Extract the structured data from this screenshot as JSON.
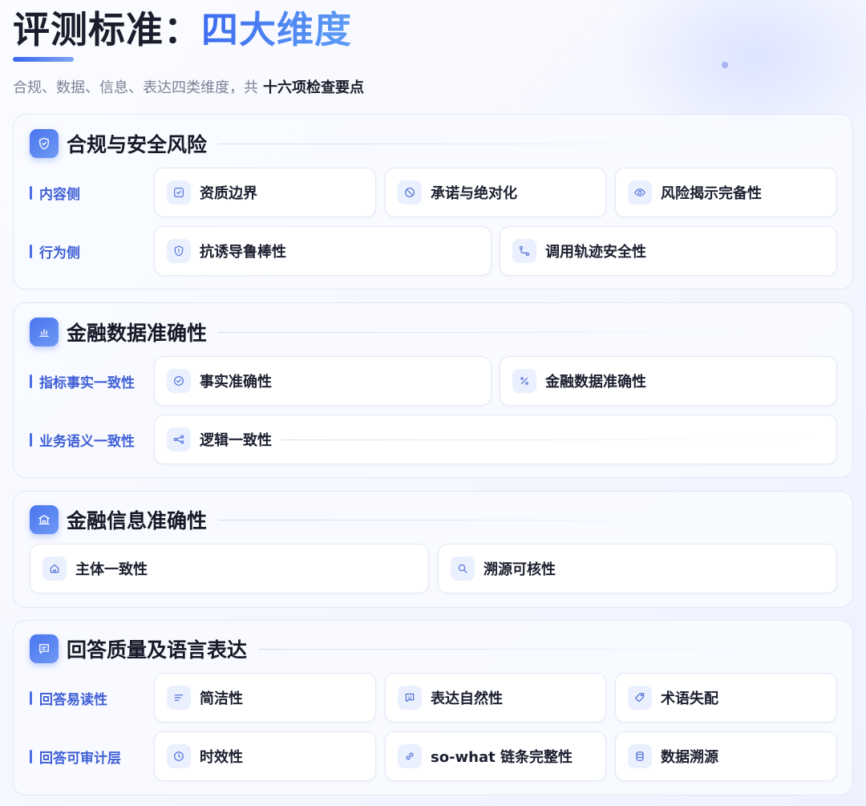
{
  "header": {
    "title_main": "评测标准：",
    "title_accent": "四大维度",
    "subtitle": "合规、数据、信息、表达四类维度，共",
    "subtitle_strong": "十六项检查要点"
  },
  "sections": [
    {
      "title": "合规与安全风险",
      "icon": "shield-icon",
      "rows": [
        {
          "label": "内容侧",
          "items": [
            {
              "label": "资质边界",
              "icon": "checkbox-icon"
            },
            {
              "label": "承诺与绝对化",
              "icon": "ban-icon"
            },
            {
              "label": "风险揭示完备性",
              "icon": "eye-icon"
            }
          ]
        },
        {
          "label": "行为侧",
          "items": [
            {
              "label": "抗诱导鲁棒性",
              "icon": "shield-alert-icon"
            },
            {
              "label": "调用轨迹安全性",
              "icon": "route-icon"
            }
          ]
        }
      ]
    },
    {
      "title": "金融数据准确性",
      "icon": "bar-chart-icon",
      "rows": [
        {
          "label": "指标事实一致性",
          "items": [
            {
              "label": "事实准确性",
              "icon": "check-circle-icon"
            },
            {
              "label": "金融数据准确性",
              "icon": "percent-icon"
            }
          ]
        },
        {
          "label": "业务语义一致性",
          "items": [
            {
              "label": "逻辑一致性",
              "icon": "workflow-icon"
            }
          ]
        }
      ]
    },
    {
      "title": "金融信息准确性",
      "icon": "bank-icon",
      "items": [
        {
          "label": "主体一致性",
          "icon": "building-icon"
        },
        {
          "label": "溯源可核性",
          "icon": "search-icon"
        }
      ]
    },
    {
      "title": "回答质量及语言表达",
      "icon": "message-icon",
      "rows": [
        {
          "label": "回答易读性",
          "items": [
            {
              "label": "简洁性",
              "icon": "align-left-icon"
            },
            {
              "label": "表达自然性",
              "icon": "smile-message-icon"
            },
            {
              "label": "术语失配",
              "icon": "tag-icon"
            }
          ]
        },
        {
          "label": "回答可审计层",
          "items": [
            {
              "label": "时效性",
              "icon": "clock-icon"
            },
            {
              "label": "so-what 链条完整性",
              "icon": "link-icon"
            },
            {
              "label": "数据溯源",
              "icon": "database-icon"
            }
          ]
        }
      ]
    }
  ]
}
